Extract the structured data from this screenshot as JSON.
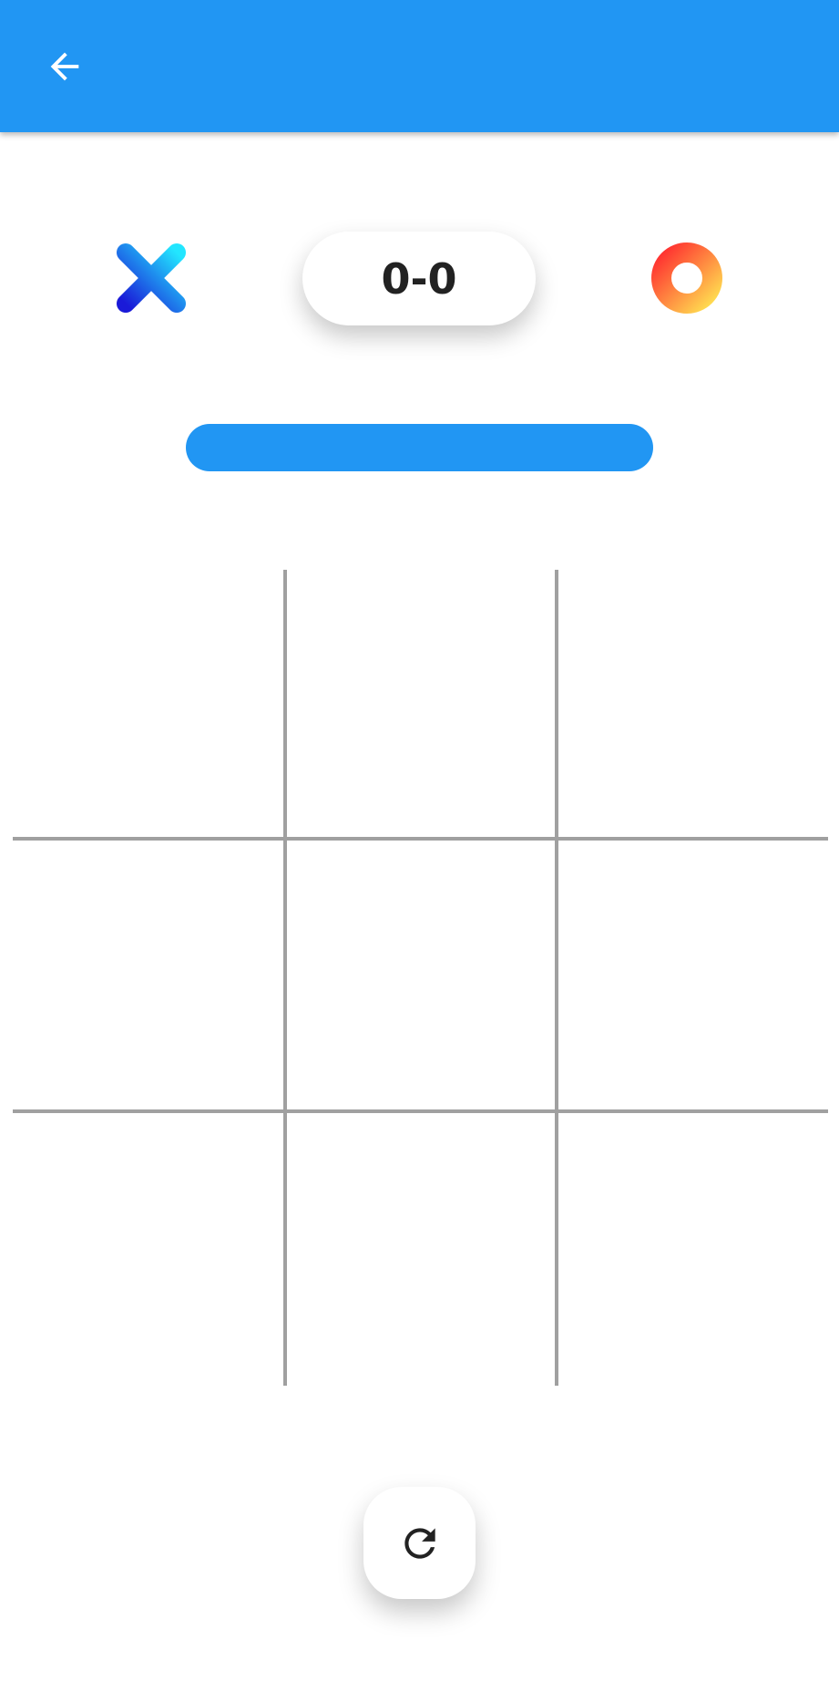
{
  "appbar": {
    "back_icon": "arrow-back-icon",
    "color": "#2196F3"
  },
  "players": {
    "x": {
      "icon": "x-player-icon",
      "colors": [
        "#1a1ad8",
        "#22e6ff"
      ]
    },
    "o": {
      "icon": "o-player-icon",
      "colors": [
        "#ff3a3a",
        "#ffd84a"
      ]
    }
  },
  "score": {
    "text": "0-0"
  },
  "turn_indicator": {
    "color": "#2196F3"
  },
  "board": {
    "cells": [
      "",
      "",
      "",
      "",
      "",
      "",
      "",
      "",
      ""
    ]
  },
  "reset": {
    "icon": "refresh-icon"
  }
}
